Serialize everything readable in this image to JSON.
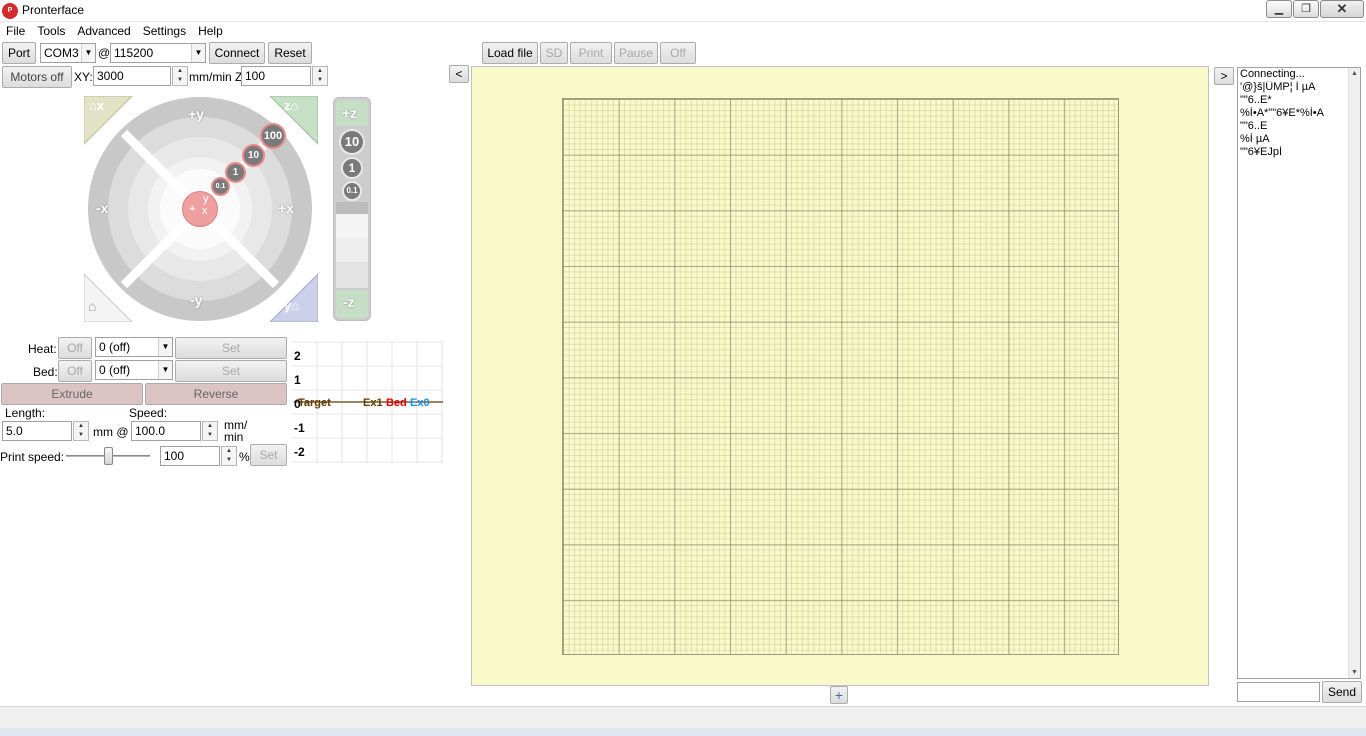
{
  "window": {
    "title": "Pronterface",
    "icon_text": "P"
  },
  "menu": [
    "File",
    "Tools",
    "Advanced",
    "Settings",
    "Help"
  ],
  "connection": {
    "port_label": "Port",
    "port_value": "COM3",
    "at_label": "@",
    "baud_value": "115200",
    "connect_label": "Connect",
    "reset_label": "Reset"
  },
  "file_controls": {
    "load_label": "Load file",
    "sd_label": "SD",
    "print_label": "Print",
    "pause_label": "Pause",
    "off_label": "Off"
  },
  "motion": {
    "motors_off_label": "Motors off",
    "xy_label": "XY:",
    "xy_value": "3000",
    "mmmin_label": "mm/min Z:",
    "z_value": "100"
  },
  "jog": {
    "home_x": "x",
    "home_z": "z",
    "home_y": "y",
    "plus_y": "+y",
    "minus_y": "-y",
    "minus_x": "-x",
    "plus_x": "+x",
    "steps": [
      "100",
      "10",
      "1",
      "0.1"
    ],
    "center_y": "y",
    "center_x": "x"
  },
  "zjog": {
    "plus_z": "+z",
    "minus_z": "-z",
    "steps": [
      "10",
      "1",
      "0.1"
    ]
  },
  "temperature": {
    "heat_label": "Heat:",
    "heat_off": "Off",
    "heat_value": "0 (off)",
    "heat_set": "Set",
    "bed_label": "Bed:",
    "bed_off": "Off",
    "bed_value": "0 (off)",
    "bed_set": "Set"
  },
  "extrude": {
    "extrude_label": "Extrude",
    "reverse_label": "Reverse",
    "length_label": "Length:",
    "speed_label": "Speed:",
    "length_value": "5.0",
    "mm_at_label": "mm @",
    "speed_value": "100.0",
    "mm_min_label": "mm/\nmin"
  },
  "print_speed": {
    "label": "Print speed:",
    "value": "100",
    "percent": "%",
    "set_label": "Set",
    "slider_level_percent": 100
  },
  "temp_graph": {
    "y_ticks": [
      "2",
      "1",
      "0",
      "-1",
      "-2"
    ],
    "legend": [
      {
        "name": "Target",
        "color": "#5c3c00"
      },
      {
        "name": "Ex1",
        "color": "#5c3c00"
      },
      {
        "name": "Bed",
        "color": "#e00000"
      },
      {
        "name": "Ex0",
        "color": "#1a8fe0"
      }
    ]
  },
  "panels": {
    "collapse_left": "<",
    "collapse_right": ">",
    "zoom_plus": "+"
  },
  "log": {
    "lines": [
      "Connecting...",
      "'@}š|ÛMP¦ Ì µA",
      "\"\"6..E*",
      "%Ì•A*\"\"6¥E*%Ì•A",
      "\"\"6..E",
      "%Ì µA",
      "\"\"6¥EJpÌ"
    ],
    "send_label": "Send",
    "input_value": ""
  },
  "colors": {
    "canvas_bg": "#f8f8c8",
    "jog_ring": "#d4d4d4",
    "accent_red": "#e88a8a"
  }
}
